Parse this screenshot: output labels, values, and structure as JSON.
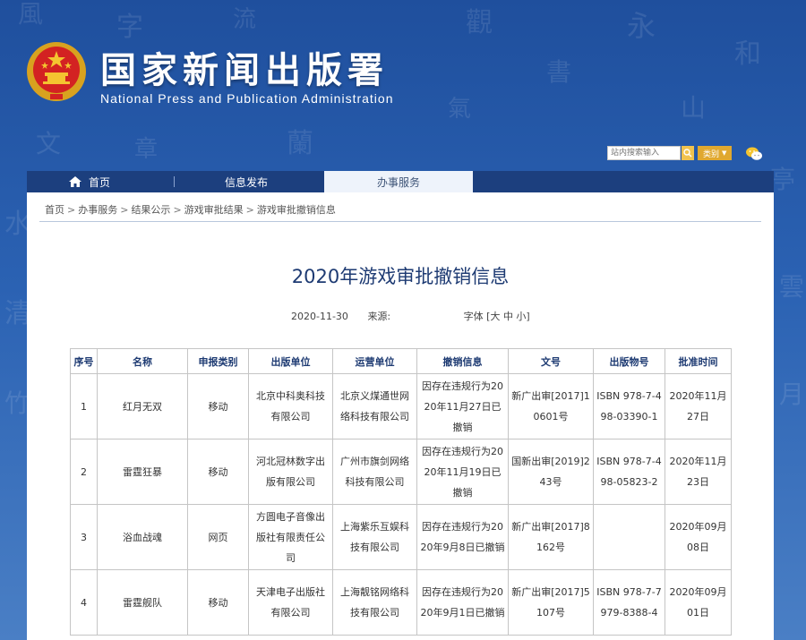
{
  "header": {
    "title_cn": "国家新闻出版署",
    "title_en": "National Press and Publication Administration",
    "search_placeholder": "站内搜索输入",
    "category_label": "类别"
  },
  "nav": {
    "items": [
      {
        "label": "首页"
      },
      {
        "label": "信息发布"
      },
      {
        "label": "办事服务"
      }
    ]
  },
  "breadcrumb": [
    "首页",
    "办事服务",
    "结果公示",
    "游戏审批结果",
    "游戏审批撤销信息"
  ],
  "page": {
    "title": "2020年游戏审批撤销信息",
    "date": "2020-11-30",
    "source_label": "来源:",
    "font_label": "字体 [大 中 小]"
  },
  "table": {
    "headers": [
      "序号",
      "名称",
      "申报类别",
      "出版单位",
      "运营单位",
      "撤销信息",
      "文号",
      "出版物号",
      "批准时间"
    ],
    "rows": [
      [
        "1",
        "红月无双",
        "移动",
        "北京中科奥科技有限公司",
        "北京义煤通世网络科技有限公司",
        "因存在违规行为2020年11月27日已撤销",
        "新广出审[2017]10601号",
        "ISBN 978-7-498-03390-1",
        "2020年11月27日"
      ],
      [
        "2",
        "雷霆狂暴",
        "移动",
        "河北冠林数字出版有限公司",
        "广州市旗剑网络科技有限公司",
        "因存在违规行为2020年11月19日已撤销",
        "国新出审[2019]243号",
        "ISBN 978-7-498-05823-2",
        "2020年11月23日"
      ],
      [
        "3",
        "浴血战魂",
        "网页",
        "方圆电子音像出版社有限责任公司",
        "上海紫乐互娱科技有限公司",
        "因存在违规行为2020年9月8日已撤销",
        "新广出审[2017]8162号",
        "",
        "2020年09月08日"
      ],
      [
        "4",
        "雷霆舰队",
        "移动",
        "天津电子出版社有限公司",
        "上海靓铭网络科技有限公司",
        "因存在违规行为2020年9月1日已撤销",
        "新广出审[2017]5107号",
        "ISBN 978-7-7979-8388-4",
        "2020年09月01日"
      ]
    ]
  },
  "colors": {
    "nav_bg": "#1c3f7e",
    "title_blue": "#1e3b73",
    "accent_gold": "#e0a82f"
  }
}
